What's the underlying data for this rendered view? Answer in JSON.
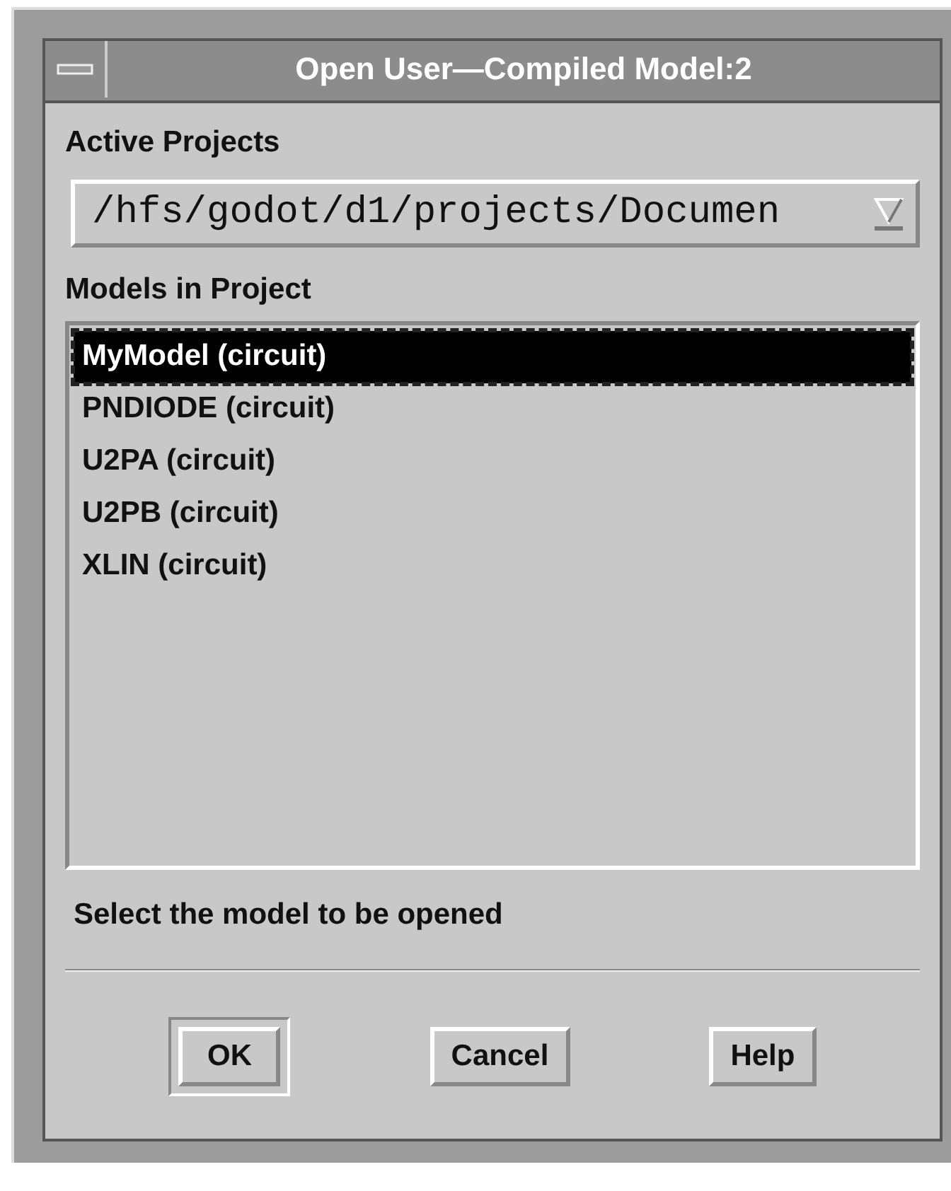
{
  "window": {
    "title": "Open User—Compiled Model:2"
  },
  "active_projects": {
    "label": "Active Projects",
    "value": "/hfs/godot/d1/projects/Documen"
  },
  "models": {
    "label": "Models in Project",
    "items": [
      {
        "label": "MyModel (circuit)",
        "selected": true
      },
      {
        "label": "PNDIODE (circuit)",
        "selected": false
      },
      {
        "label": "U2PA (circuit)",
        "selected": false
      },
      {
        "label": "U2PB (circuit)",
        "selected": false
      },
      {
        "label": "XLIN (circuit)",
        "selected": false
      }
    ]
  },
  "status": "Select the model to be opened",
  "buttons": [
    {
      "label": "OK",
      "default": true
    },
    {
      "label": "Cancel",
      "default": false
    },
    {
      "label": "Help",
      "default": false
    }
  ]
}
